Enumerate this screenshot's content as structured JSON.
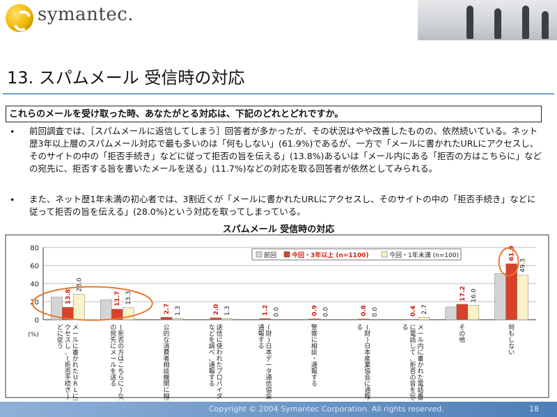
{
  "brand": {
    "name": "symantec."
  },
  "slide": {
    "title": "13. スパムメール 受信時の対応",
    "question": "これらのメールを受け取った時、あなたがとる対応は、下記のどれとどれですか。",
    "bullet_symbol": "•",
    "paragraph1": "前回調査では、［スパムメールに返信してしまう］回答者が多かったが、その状況はやや改善したものの、依然続いている。ネット歴3年以上層のスパムメール対応で最も多いのは「何もしない」(61.9%)であるが、一方で「メールに書かれたURLにアクセスし、そのサイトの中の「拒否手続き」などに従って拒否の旨を伝える」(13.8%)あるいは「メール内にある「拒否の方はこちらに」などの宛先に、拒否する旨を書いたメールを送る」(11.7%)などの対応を取る回答者が依然としてみられる。",
    "paragraph2": "また、ネット歴1年未満の初心者では、3割近くが「メールに書かれたURLにアクセスし、そのサイトの中の「拒否手続き」などに従って拒否の旨を伝える」(28.0%)という対応を取ってしまっている。"
  },
  "footer": {
    "copyright": "Copyright © 2004 Symantec Corporation. All rights reserved.",
    "page": "18"
  },
  "chart_data": {
    "type": "bar",
    "title": "スパムメール 受信時の対応",
    "ylabel": "(%)",
    "ylim": [
      0,
      80
    ],
    "yticks": [
      0,
      20,
      40,
      60,
      80
    ],
    "grid": true,
    "legend_position": "top-right",
    "categories": [
      "メールに書かれたURLにアクセスし、(拒否手続き)などに従う",
      "(拒否の方はこちらに)などの宛先にメールを送る",
      "公的な消費者相談機関に相談",
      "送信に使われたプロバイダーなどを調べ、通報する",
      "(財)日本データ通信協会に通報する",
      "警察に相談・通報する",
      "(財)日本産業協会に通報する",
      "メール内に書かれた電話番号に電話して、拒否の旨を伝える",
      "その他",
      "何もしない"
    ],
    "series": [
      {
        "name": "前回",
        "color": "#d4d4d4",
        "values": [
          25,
          22,
          0,
          0,
          0,
          0,
          0,
          0,
          14,
          51
        ]
      },
      {
        "name": "今回・3年以上 (n=1100)",
        "color": "#d9412a",
        "values": [
          13.8,
          11.7,
          2.7,
          2.0,
          1.2,
          0.9,
          0.8,
          0.4,
          17.2,
          61.9
        ],
        "labels": [
          "13.8",
          "11.7",
          "2.7",
          "2.0",
          "1.2",
          "0.9",
          "0.8",
          "0.4",
          "17.2",
          "61.9"
        ]
      },
      {
        "name": "今回・1年未満 (n=100)",
        "color": "#fbf3c6",
        "values": [
          28.0,
          13.3,
          1.3,
          1.3,
          0.0,
          0.0,
          0.0,
          2.7,
          16.0,
          49.3
        ],
        "labels": [
          "28.0",
          "13.3",
          "1.3",
          "1.3",
          "0.0",
          "0.0",
          "0.0",
          "2.7",
          "16.0",
          "49.3"
        ]
      }
    ]
  }
}
